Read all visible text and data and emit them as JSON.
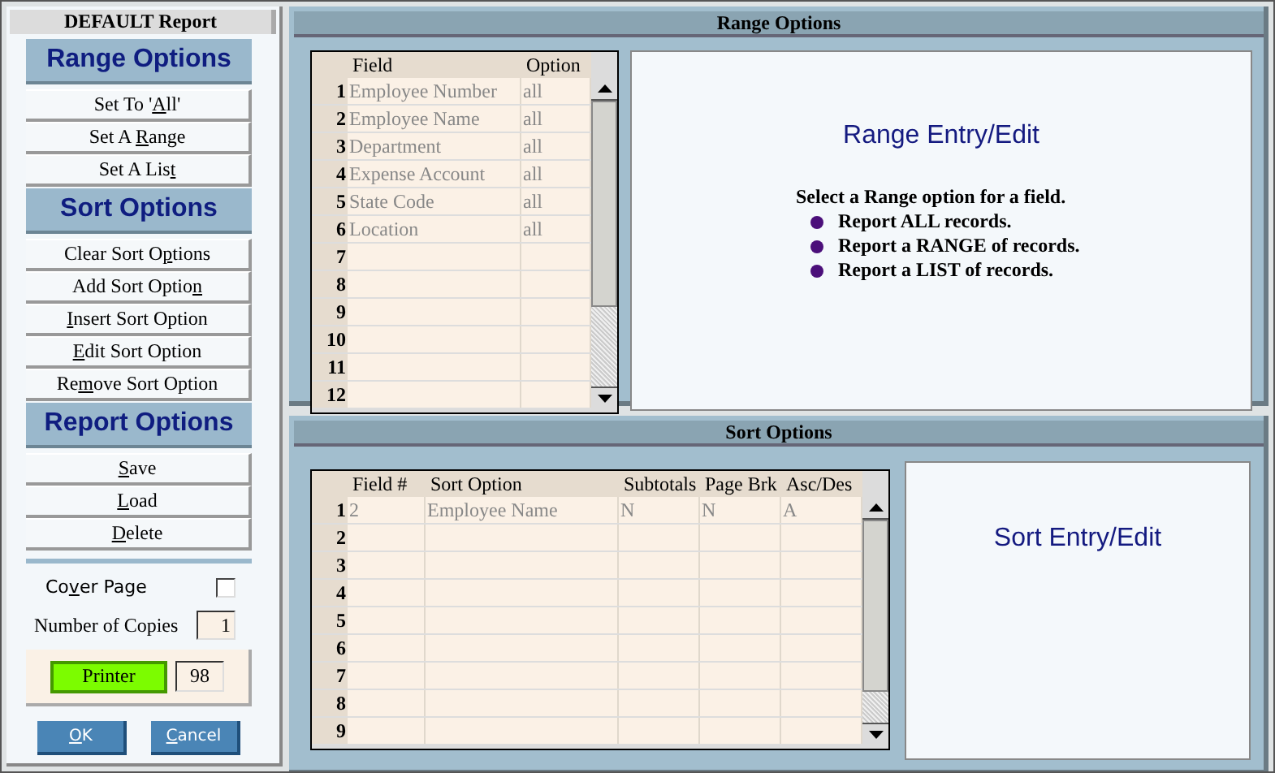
{
  "left_panel": {
    "title": "DEFAULT Report",
    "sections": [
      {
        "title": "Range Options",
        "buttons": [
          {
            "label": {
              "before": "Set To '",
              "key": "A",
              "after": "ll'"
            }
          },
          {
            "label": {
              "before": "Set A ",
              "key": "R",
              "after": "ange"
            }
          },
          {
            "label": {
              "before": "Set A Lis",
              "key": "t"
            }
          }
        ]
      },
      {
        "title": "Sort Options",
        "buttons": [
          {
            "label": {
              "before": "Clear Sort O",
              "key": "p",
              "after": "tions"
            }
          },
          {
            "label": {
              "before": "Add Sort Optio",
              "key": "n"
            }
          },
          {
            "label": {
              "key": "I",
              "after": "nsert Sort Option"
            }
          },
          {
            "label": {
              "key": "E",
              "after": "dit Sort Option"
            }
          },
          {
            "label": {
              "before": "Re",
              "key": "m",
              "after": "ove Sort Option"
            }
          }
        ]
      },
      {
        "title": "Report Options",
        "buttons": [
          {
            "label": {
              "key": "S",
              "after": "ave"
            }
          },
          {
            "label": {
              "key": "L",
              "after": "oad"
            }
          },
          {
            "label": {
              "key": "D",
              "after": "elete"
            }
          }
        ]
      }
    ],
    "cover_page": {
      "label": {
        "before": "Co",
        "key": "v",
        "after": "er Page"
      },
      "checked": false
    },
    "copies": {
      "label": "Number of Copies",
      "value": "1"
    },
    "printer": {
      "label": "Printer",
      "value": "98"
    },
    "buttons": [
      {
        "label": {
          "key": "O",
          "after": "K"
        }
      },
      {
        "label": {
          "key": "C",
          "after": "ancel"
        }
      }
    ]
  },
  "range_panel": {
    "title": "Range Options",
    "table": {
      "columns": [
        "Field",
        "Option"
      ],
      "rows": [
        {
          "num": "1",
          "cells": [
            "Employee Number",
            "all"
          ]
        },
        {
          "num": "2",
          "cells": [
            "Employee Name",
            "all"
          ]
        },
        {
          "num": "3",
          "cells": [
            "Department",
            "all"
          ]
        },
        {
          "num": "4",
          "cells": [
            "Expense Account",
            "all"
          ]
        },
        {
          "num": "5",
          "cells": [
            "State Code",
            "all"
          ]
        },
        {
          "num": "6",
          "cells": [
            "Location",
            "all"
          ]
        },
        {
          "num": "7"
        },
        {
          "num": "8"
        },
        {
          "num": "9"
        },
        {
          "num": "10"
        },
        {
          "num": "11"
        },
        {
          "num": "12"
        }
      ]
    },
    "info": {
      "title": "Range Entry/Edit",
      "intro": "Select a Range option for a field.",
      "bullets": [
        "Report ALL records.",
        "Report a RANGE of records.",
        "Report a LIST of records."
      ]
    }
  },
  "sort_panel": {
    "title": "Sort Options",
    "table": {
      "columns": [
        "Field #",
        "Sort Option",
        "Subtotals",
        "Page Brk",
        "Asc/Des"
      ],
      "rows": [
        {
          "num": "1",
          "cells": [
            "2",
            "Employee Name",
            "N",
            "N",
            "A"
          ]
        },
        {
          "num": "2"
        },
        {
          "num": "3"
        },
        {
          "num": "4"
        },
        {
          "num": "5"
        },
        {
          "num": "6"
        },
        {
          "num": "7"
        },
        {
          "num": "8"
        },
        {
          "num": "9"
        }
      ]
    },
    "info": {
      "title": "Sort Entry/Edit"
    }
  }
}
